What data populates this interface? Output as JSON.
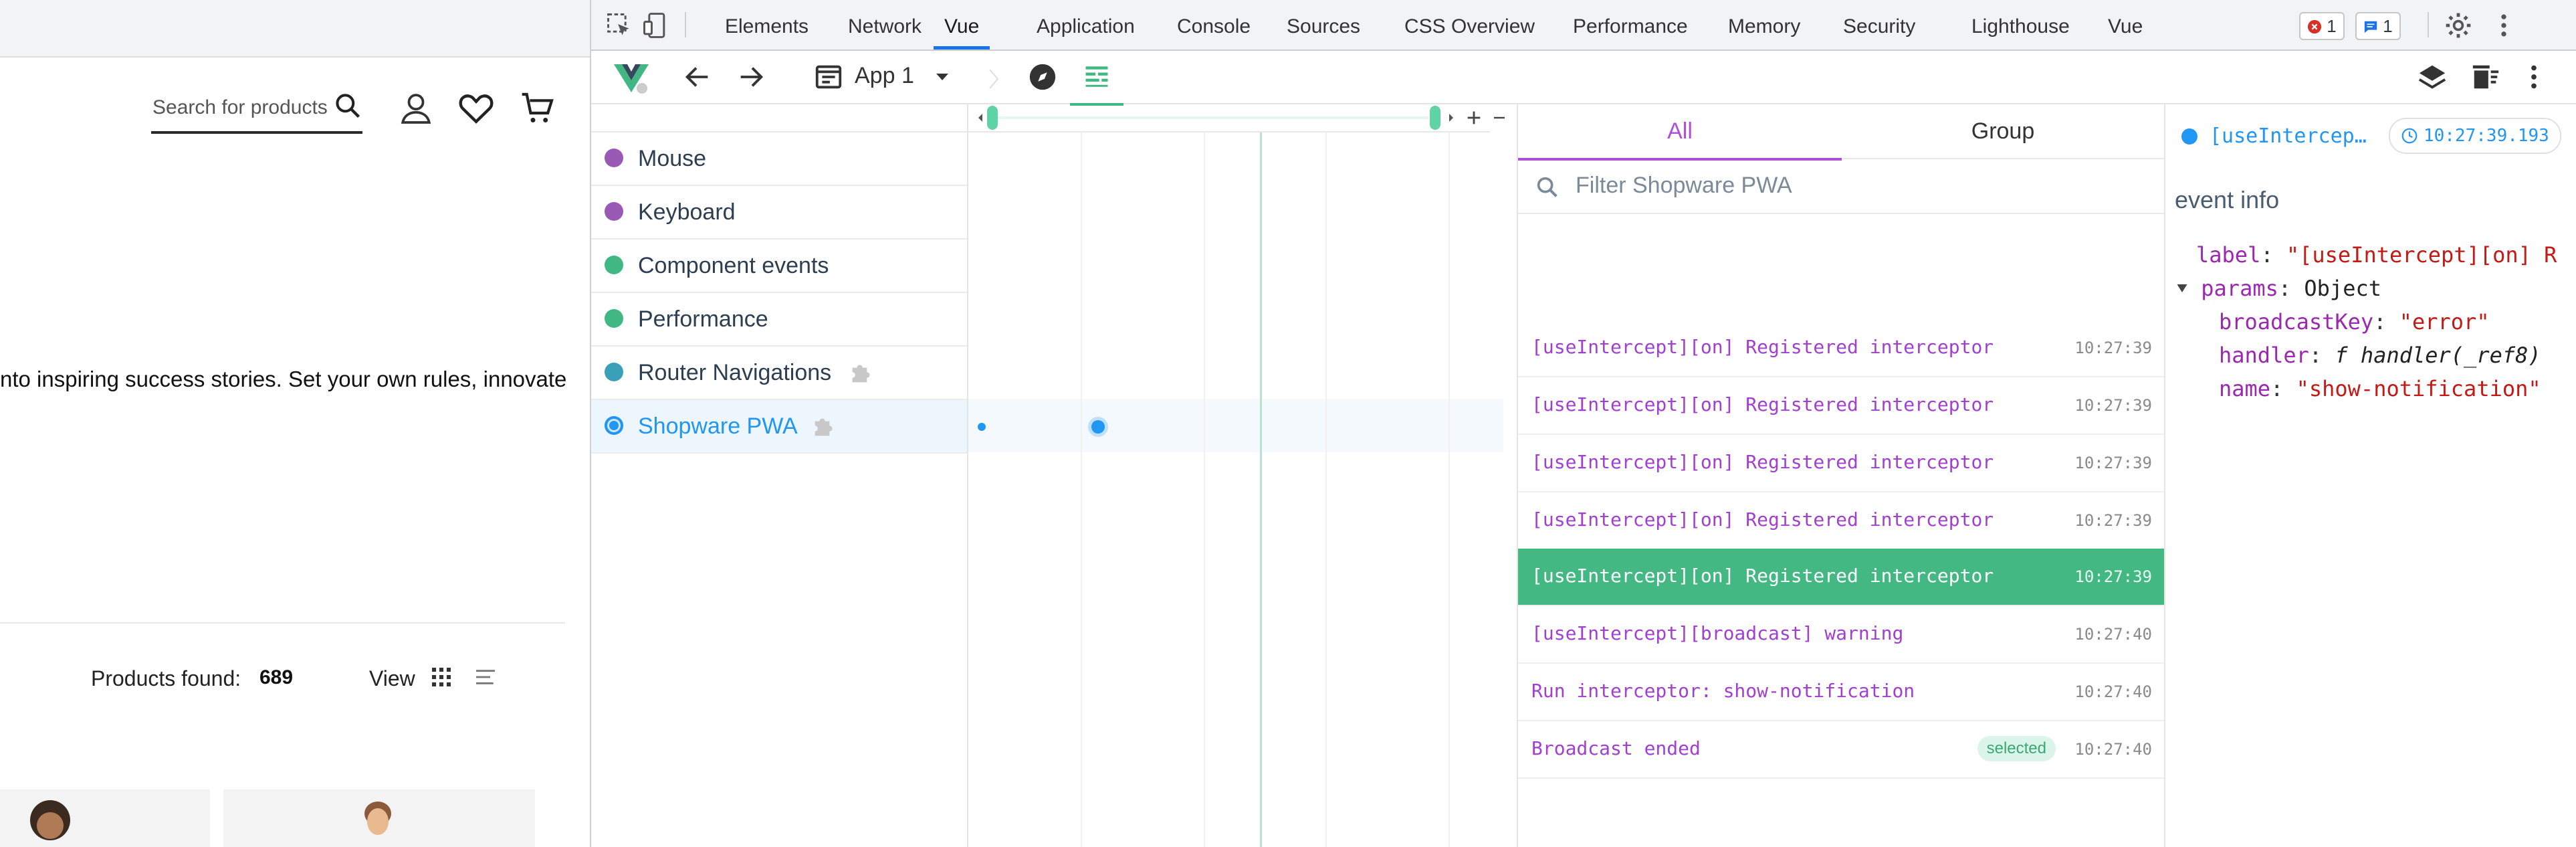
{
  "site": {
    "search_placeholder": "Search for products",
    "promo_text": "nto inspiring success stories. Set your own rules, innovate",
    "products_found_label": "Products found:",
    "products_found_value": "689",
    "view_label": "View"
  },
  "devtools": {
    "tabs": [
      "Elements",
      "Network",
      "Vue",
      "Application",
      "Console",
      "Sources",
      "CSS Overview",
      "Performance",
      "Memory",
      "Security",
      "Lighthouse",
      "Vue"
    ],
    "active_tab": "Vue",
    "errors_count": "1",
    "messages_count": "1"
  },
  "vue": {
    "app_name": "App 1",
    "layers": [
      {
        "label": "Mouse",
        "color": "#9b59b6"
      },
      {
        "label": "Keyboard",
        "color": "#9b59b6"
      },
      {
        "label": "Component events",
        "color": "#41b883"
      },
      {
        "label": "Performance",
        "color": "#41b883"
      },
      {
        "label": "Router Navigations",
        "color": "#3aa0b8"
      },
      {
        "label": "Shopware PWA",
        "color": "#2196f3"
      }
    ],
    "selected_layer": "Shopware PWA",
    "event_tabs": {
      "all": "All",
      "group": "Group"
    },
    "filter_placeholder": "Filter Shopware PWA",
    "events": [
      {
        "text": "[useIntercept][on] Registered interceptor",
        "time": "10:27:39"
      },
      {
        "text": "[useIntercept][on] Registered interceptor",
        "time": "10:27:39"
      },
      {
        "text": "[useIntercept][on] Registered interceptor",
        "time": "10:27:39"
      },
      {
        "text": "[useIntercept][on] Registered interceptor",
        "time": "10:27:39"
      },
      {
        "text": "[useIntercept][on] Registered interceptor",
        "time": "10:27:39"
      },
      {
        "text": "[useIntercept][broadcast] warning",
        "time": "10:27:40"
      },
      {
        "text": "Run interceptor: show-notification",
        "time": "10:27:40"
      },
      {
        "text": "Broadcast ended",
        "time": "10:27:40",
        "tag": "selected"
      }
    ],
    "selected_event_index": 4,
    "inspector": {
      "title": "[useIntercep…",
      "time": "10:27:39.193",
      "section": "event info",
      "label_key": "label",
      "label_value": "\"[useIntercept][on] R",
      "params_key": "params",
      "params_value": "Object",
      "params_fields": [
        {
          "key": "broadcastKey",
          "value": "\"error\"",
          "kind": "str"
        },
        {
          "key": "handler",
          "value": "f handler(_ref8)",
          "kind": "fn"
        },
        {
          "key": "name",
          "value": "\"show-notification\"",
          "kind": "str"
        }
      ]
    }
  }
}
